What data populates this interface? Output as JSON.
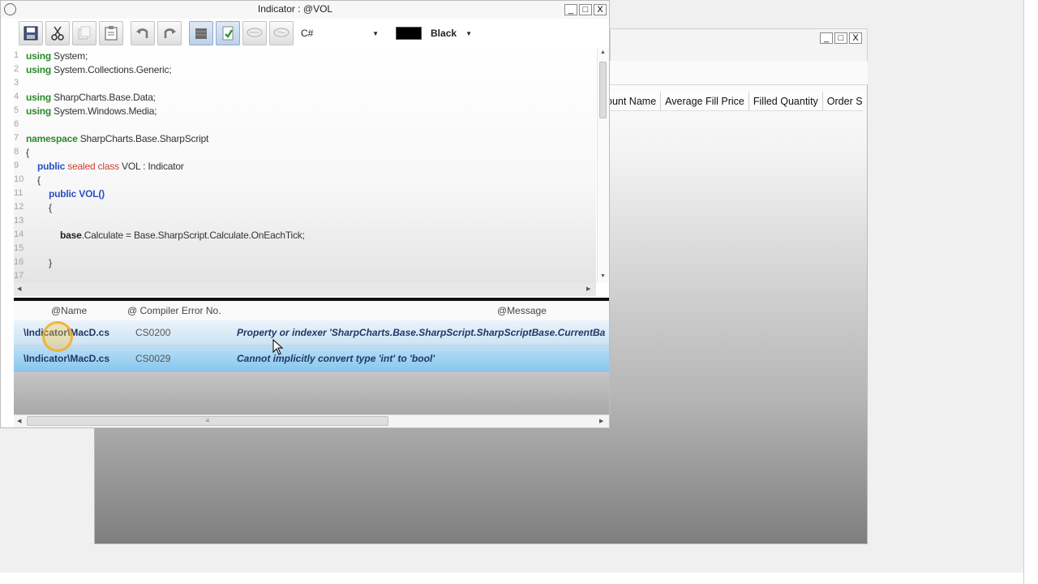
{
  "editor_window": {
    "title": "Indicator : @VOL",
    "controls": {
      "minimize": "_",
      "maximize": "□",
      "close": "X"
    }
  },
  "toolbar": {
    "buttons": [
      "save-icon",
      "cut-icon",
      "copy-icon",
      "paste-icon",
      "undo-icon",
      "redo-icon",
      "build-icon",
      "compile-icon",
      "comment-icon",
      "uncomment-icon"
    ],
    "language": "C#",
    "color_name": "Black",
    "color_value": "#000000"
  },
  "code": {
    "line_numbers": [
      "1",
      "2",
      "3",
      "4",
      "5",
      "6",
      "7",
      "8",
      "9",
      "10",
      "11",
      "12",
      "13",
      "14",
      "15",
      "16",
      "17"
    ],
    "lines": [
      {
        "kw": "using",
        "rest": " System;"
      },
      {
        "kw": "using",
        "rest": " System.Collections.Generic;"
      },
      {
        "kw": "",
        "rest": ""
      },
      {
        "kw": "using",
        "rest": " SharpCharts.Base.Data;"
      },
      {
        "kw": "using",
        "rest": " System.Windows.Media;"
      },
      {
        "kw": "",
        "rest": ""
      },
      {
        "kw": "namespace",
        "rest": " SharpCharts.Base.SharpScript"
      },
      {
        "kw": "",
        "rest": "{"
      }
    ],
    "class_line": {
      "public": "public",
      "sealed": "sealed class",
      "rest": " VOL : Indicator"
    },
    "brace_open_1": "{",
    "ctor_line": {
      "public": "public",
      "name": " VOL()"
    },
    "brace_open_2": "{",
    "calc_line": {
      "base": "base",
      "rest": ".Calculate = Base.SharpScript.Calculate.OnEachTick;"
    },
    "brace_close": "}"
  },
  "errors": {
    "columns": [
      "@Name",
      "@ Compiler Error No.",
      "@Message"
    ],
    "rows": [
      {
        "name": "\\Indicator\\MacD.cs",
        "code": "CS0200",
        "message": "Property or indexer 'SharpCharts.Base.SharpScript.SharpScriptBase.CurrentBa"
      },
      {
        "name": "\\Indicator\\MacD.cs",
        "code": "CS0029",
        "message": "Cannot implicitly convert type 'int' to 'bool'"
      }
    ]
  },
  "background_window": {
    "controls": {
      "minimize": "_",
      "maximize": "□",
      "close": "X"
    },
    "columns": [
      "ount Name",
      "Average Fill Price",
      "Filled Quantity",
      "Order S"
    ]
  }
}
